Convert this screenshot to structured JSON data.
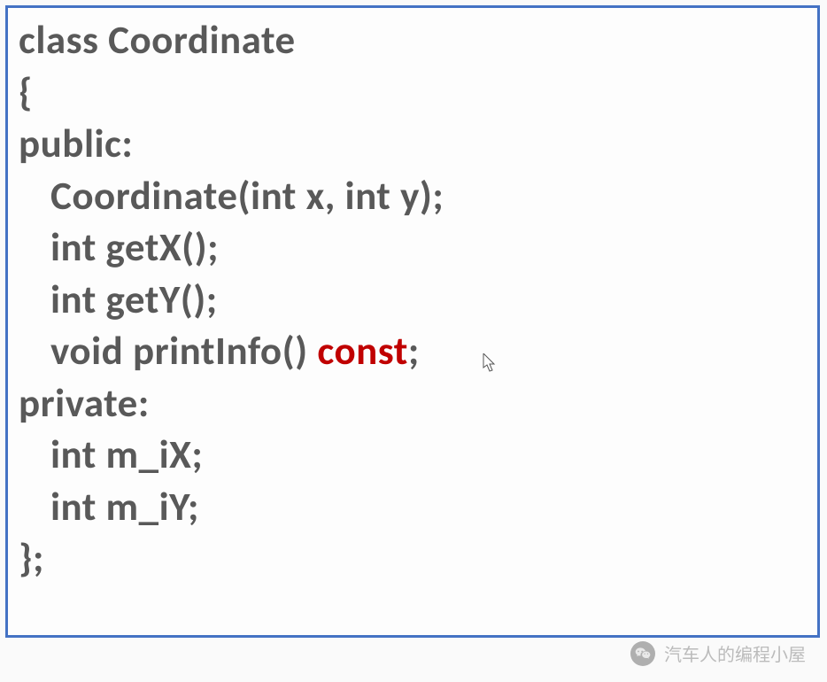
{
  "code": {
    "lines": [
      {
        "indent": 0,
        "segments": [
          {
            "text": "class Coordinate",
            "style": "normal"
          }
        ]
      },
      {
        "indent": 0,
        "segments": [
          {
            "text": "{",
            "style": "normal"
          }
        ]
      },
      {
        "indent": 0,
        "segments": [
          {
            "text": "public:",
            "style": "normal"
          }
        ]
      },
      {
        "indent": 1,
        "segments": [
          {
            "text": "Coordinate(int x, int y);",
            "style": "normal"
          }
        ]
      },
      {
        "indent": 1,
        "segments": [
          {
            "text": "int getX();",
            "style": "normal"
          }
        ]
      },
      {
        "indent": 1,
        "segments": [
          {
            "text": "int getY();",
            "style": "normal"
          }
        ]
      },
      {
        "indent": 1,
        "segments": [
          {
            "text": "void printInfo() ",
            "style": "normal"
          },
          {
            "text": "const",
            "style": "red"
          },
          {
            "text": ";",
            "style": "normal"
          }
        ]
      },
      {
        "indent": 0,
        "segments": [
          {
            "text": "private:",
            "style": "normal"
          }
        ]
      },
      {
        "indent": 1,
        "segments": [
          {
            "text": "int m_iX;",
            "style": "normal"
          }
        ]
      },
      {
        "indent": 1,
        "segments": [
          {
            "text": "int m_iY;",
            "style": "normal"
          }
        ]
      },
      {
        "indent": 0,
        "segments": [
          {
            "text": "};",
            "style": "normal"
          }
        ]
      }
    ]
  },
  "watermark": {
    "text": "汽车人的编程小屋"
  }
}
